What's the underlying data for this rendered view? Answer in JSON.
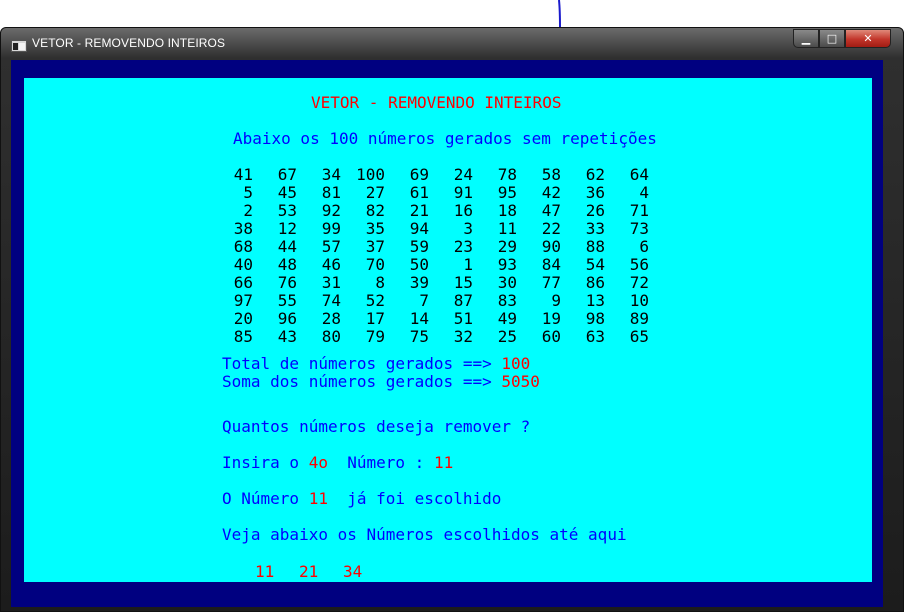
{
  "window": {
    "title": "VETOR - REMOVENDO INTEIROS",
    "controls": [
      "minimize",
      "maximize",
      "close"
    ]
  },
  "console": {
    "heading": "VETOR - REMOVENDO INTEIROS",
    "subheading": "Abaixo os 100 números gerados sem repetições",
    "numbers": [
      [
        41,
        67,
        34,
        100,
        69,
        24,
        78,
        58,
        62,
        64
      ],
      [
        5,
        45,
        81,
        27,
        61,
        91,
        95,
        42,
        36,
        4
      ],
      [
        2,
        53,
        92,
        82,
        21,
        16,
        18,
        47,
        26,
        71
      ],
      [
        38,
        12,
        99,
        35,
        94,
        3,
        11,
        22,
        33,
        73
      ],
      [
        68,
        44,
        57,
        37,
        59,
        23,
        29,
        90,
        88,
        6
      ],
      [
        40,
        48,
        46,
        70,
        50,
        1,
        93,
        84,
        54,
        56
      ],
      [
        66,
        76,
        31,
        8,
        39,
        15,
        30,
        77,
        86,
        72
      ],
      [
        97,
        55,
        74,
        52,
        7,
        87,
        83,
        9,
        13,
        10
      ],
      [
        20,
        96,
        28,
        17,
        14,
        51,
        49,
        19,
        98,
        89
      ],
      [
        85,
        43,
        80,
        79,
        75,
        32,
        25,
        60,
        63,
        65
      ]
    ],
    "total_label": "Total de números gerados ==> ",
    "total_value": "100",
    "sum_label": "Soma dos números gerados ==> ",
    "sum_value": "5050",
    "remove_prompt": "Quantos números deseja remover ?",
    "insert_label_a": "Insira o ",
    "insert_ordinal": "4o",
    "insert_label_b": "  Número : ",
    "insert_value": "11",
    "chosen_msg_a": "O Número ",
    "chosen_msg_value": "11",
    "chosen_msg_b": "  já foi escolhido",
    "chosen_list_label": "Veja abaixo os Números escolhidos até aqui",
    "chosen_list": [
      "11",
      "21",
      "34"
    ]
  },
  "colors": {
    "console_background": "#00ffff",
    "console_border": "#000080",
    "text_blue": "#0000ff",
    "text_red": "#ff0000",
    "text_black": "#000000"
  }
}
